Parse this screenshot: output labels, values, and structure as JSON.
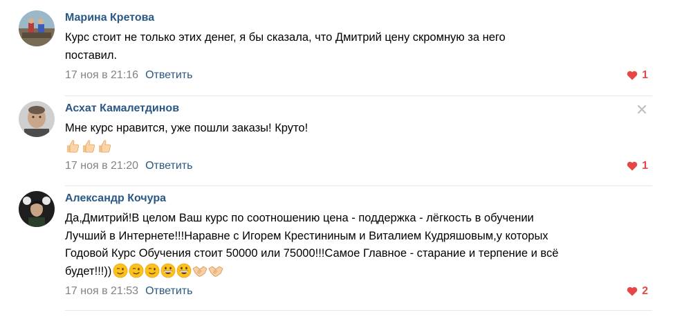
{
  "comments": [
    {
      "author": "Марина Кретова",
      "lines": [
        "Курс стоит не только этих денег, я бы сказала, что Дмитрий цену скромную за него",
        "поставил."
      ],
      "date": "17 ноя в 21:16",
      "reply_label": "Ответить",
      "likes": "1"
    },
    {
      "author": "Асхат Камалетдинов",
      "lines": [
        "Мне курс нравится, уже пошли заказы! Круто!"
      ],
      "emojis": [
        "thumbs-up",
        "thumbs-up",
        "thumbs-up"
      ],
      "date": "17 ноя в 21:20",
      "reply_label": "Ответить",
      "likes": "1"
    },
    {
      "author": "Александр Кочура",
      "lines": [
        "Да,Дмитрий!В целом Ваш курс по соотношению цена - поддержка - лёгкость в обучении",
        "Лучший в Интернете!!!Наравне с Игорем Крестининым и Виталием Кудряшовым,у которых",
        "Годовой Курс Обучения стоит 50000 или 75000!!!Самое Главное - старание и терпение и всё",
        "будет!!!))"
      ],
      "emojis": [
        "winking-face",
        "winking-face",
        "winking-face",
        "grinning-face",
        "grinning-face",
        "handshake",
        "handshake"
      ],
      "date": "17 ноя в 21:53",
      "reply_label": "Ответить",
      "likes": "2"
    }
  ],
  "colors": {
    "link": "#2a5885",
    "meta": "#828282",
    "like": "#e64646",
    "divider": "#e7e8ec"
  }
}
